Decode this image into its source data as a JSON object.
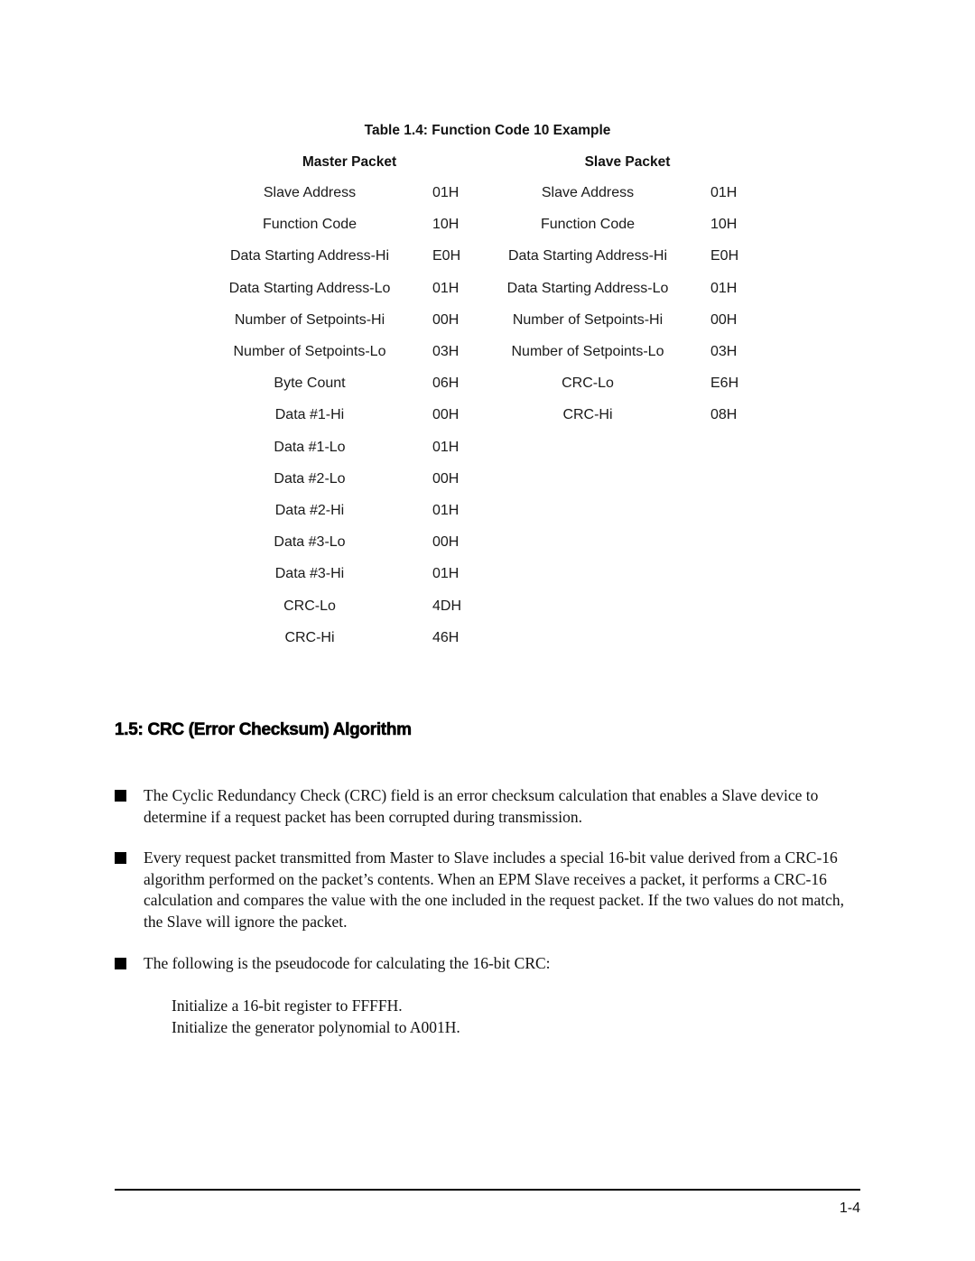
{
  "table": {
    "caption": "Table 1.4: Function Code 10 Example",
    "master_header": "Master Packet",
    "slave_header": "Slave Packet",
    "master_rows": [
      {
        "label": "Slave Address",
        "value": "01H"
      },
      {
        "label": "Function Code",
        "value": "10H"
      },
      {
        "label": "Data Starting Address-Hi",
        "value": "E0H"
      },
      {
        "label": "Data Starting Address-Lo",
        "value": "01H"
      },
      {
        "label": "Number of Setpoints-Hi",
        "value": "00H"
      },
      {
        "label": "Number of Setpoints-Lo",
        "value": "03H"
      },
      {
        "label": "Byte Count",
        "value": "06H"
      },
      {
        "label": "Data #1-Hi",
        "value": "00H"
      },
      {
        "label": "Data #1-Lo",
        "value": "01H"
      },
      {
        "label": "Data #2-Lo",
        "value": "00H"
      },
      {
        "label": "Data #2-Hi",
        "value": "01H"
      },
      {
        "label": "Data #3-Lo",
        "value": "00H"
      },
      {
        "label": "Data #3-Hi",
        "value": "01H"
      },
      {
        "label": "CRC-Lo",
        "value": "4DH"
      },
      {
        "label": "CRC-Hi",
        "value": "46H"
      }
    ],
    "slave_rows": [
      {
        "label": "Slave Address",
        "value": "01H"
      },
      {
        "label": "Function Code",
        "value": "10H"
      },
      {
        "label": "Data Starting Address-Hi",
        "value": "E0H"
      },
      {
        "label": "Data Starting Address-Lo",
        "value": "01H"
      },
      {
        "label": "Number of Setpoints-Hi",
        "value": "00H"
      },
      {
        "label": "Number of Setpoints-Lo",
        "value": "03H"
      },
      {
        "label": "CRC-Lo",
        "value": "E6H"
      },
      {
        "label": "CRC-Hi",
        "value": "08H"
      }
    ]
  },
  "section": {
    "heading": "1.5: CRC (Error Checksum) Algorithm",
    "bullets": [
      "The Cyclic Redundancy Check (CRC) field is an error checksum calculation that enables a Slave device to determine if a request packet has been corrupted during transmission.",
      "Every request packet transmitted from Master to Slave includes a special 16-bit value derived from a CRC-16 algorithm performed on the packet’s contents. When an EPM Slave receives a packet, it performs a CRC-16 calculation and compares the value with the one included in the request packet. If the two values do not match, the Slave will ignore the packet.",
      "The following is the pseudocode for calculating the 16-bit CRC:"
    ],
    "pseudocode": [
      "Initialize a 16-bit register to FFFFH.",
      "Initialize the generator polynomial to A001H."
    ]
  },
  "footer": {
    "page_number": "1-4"
  }
}
